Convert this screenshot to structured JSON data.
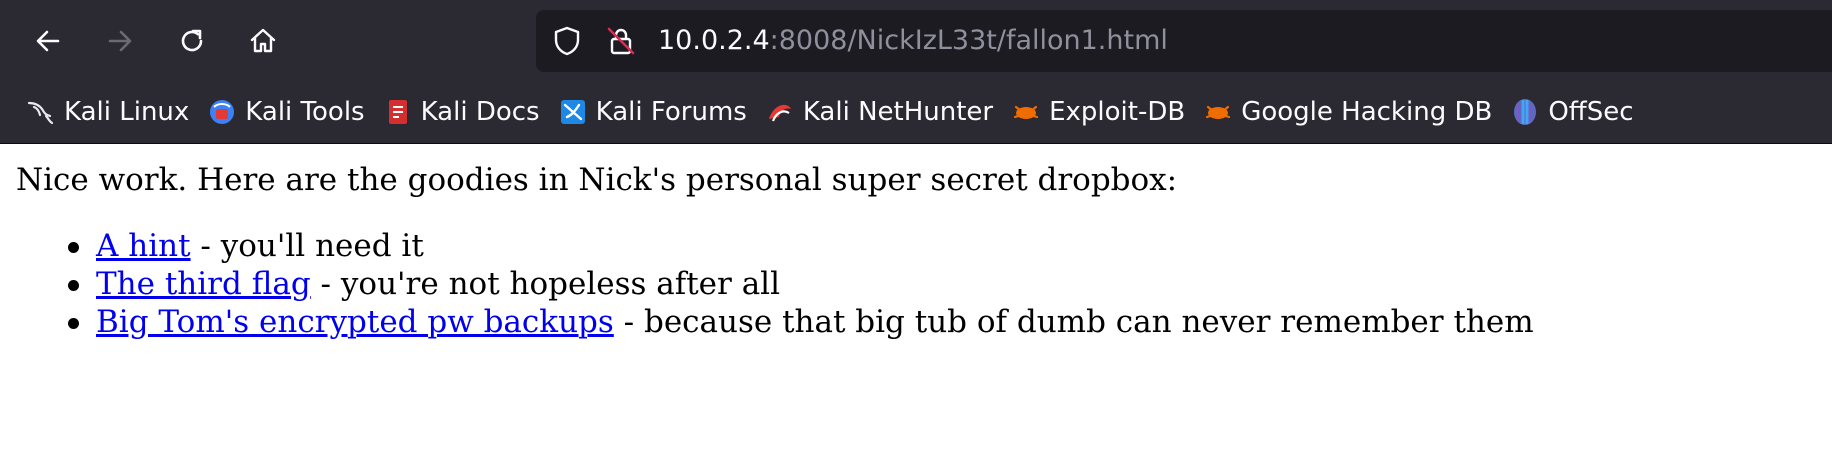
{
  "browser": {
    "url_host": "10.0.2.4",
    "url_rest": ":8008/NickIzL33t/fallon1.html",
    "bookmarks": [
      {
        "label": "Kali Linux",
        "icon": "kali-dragon-icon"
      },
      {
        "label": "Kali Tools",
        "icon": "kali-tools-icon"
      },
      {
        "label": "Kali Docs",
        "icon": "kali-docs-icon"
      },
      {
        "label": "Kali Forums",
        "icon": "kali-forums-icon"
      },
      {
        "label": "Kali NetHunter",
        "icon": "kali-nethunter-icon"
      },
      {
        "label": "Exploit-DB",
        "icon": "exploit-db-icon"
      },
      {
        "label": "Google Hacking DB",
        "icon": "google-hacking-db-icon"
      },
      {
        "label": "OffSec",
        "icon": "offsec-icon"
      }
    ]
  },
  "page": {
    "intro": "Nice work. Here are the goodies in Nick's personal super secret dropbox:",
    "items": [
      {
        "link": "A hint",
        "text": " - you'll need it"
      },
      {
        "link": "The third flag",
        "text": " - you're not hopeless after all"
      },
      {
        "link": "Big Tom's encrypted pw backups",
        "text": " - because that big tub of dumb can never remember them"
      }
    ]
  },
  "colors": {
    "chrome_bg": "#2b2a33",
    "urlbar_bg": "#1c1b22",
    "link": "#0000ee"
  }
}
